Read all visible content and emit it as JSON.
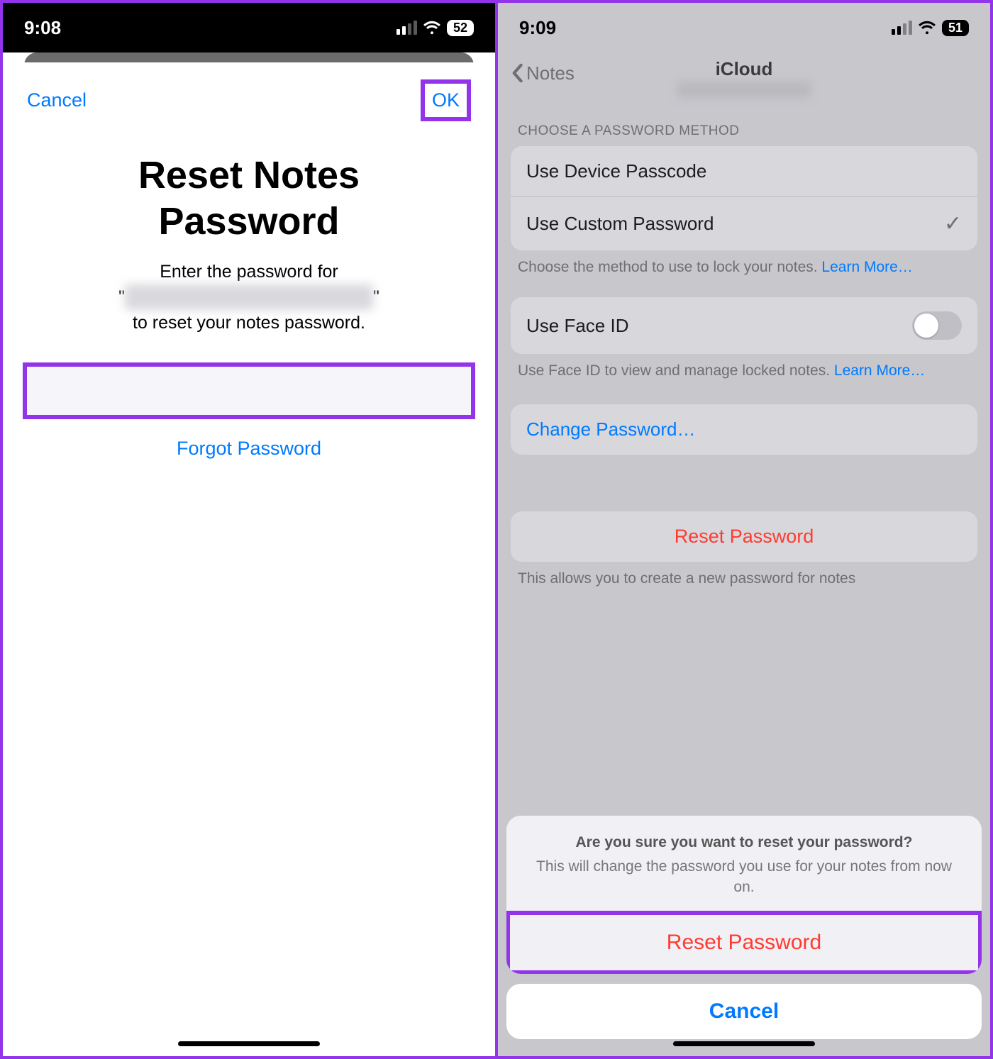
{
  "left": {
    "status": {
      "time": "9:08",
      "battery": "52"
    },
    "nav": {
      "cancel": "Cancel",
      "ok": "OK"
    },
    "title_line1": "Reset Notes",
    "title_line2": "Password",
    "desc_line1": "Enter the password for",
    "desc_quote_open": "\"",
    "desc_blur": "xxxxxxxxxxxxxxxxxxxxxxxxxxxx",
    "desc_quote_close": "\"",
    "desc_line3": "to reset your notes password.",
    "forgot": "Forgot Password"
  },
  "right": {
    "status": {
      "time": "9:09",
      "battery": "51"
    },
    "nav": {
      "back": "Notes",
      "title": "iCloud",
      "subtitle_blur": "xxxxxxxxxxxxxxxxxx"
    },
    "section1_header": "CHOOSE A PASSWORD METHOD",
    "rows": {
      "device_passcode": "Use Device Passcode",
      "custom_password": "Use Custom Password"
    },
    "section1_footer_text": "Choose the method to use to lock your notes. ",
    "learn_more": "Learn More…",
    "faceid_label": "Use Face ID",
    "faceid_footer": "Use Face ID to view and manage locked notes. ",
    "change_password": "Change Password…",
    "reset_password_row": "Reset Password",
    "reset_footer": "This allows you to create a new password for notes",
    "sheet": {
      "question": "Are you sure you want to reset your password?",
      "explain": "This will change the password you use for your notes from now on.",
      "reset": "Reset Password",
      "cancel": "Cancel"
    }
  }
}
